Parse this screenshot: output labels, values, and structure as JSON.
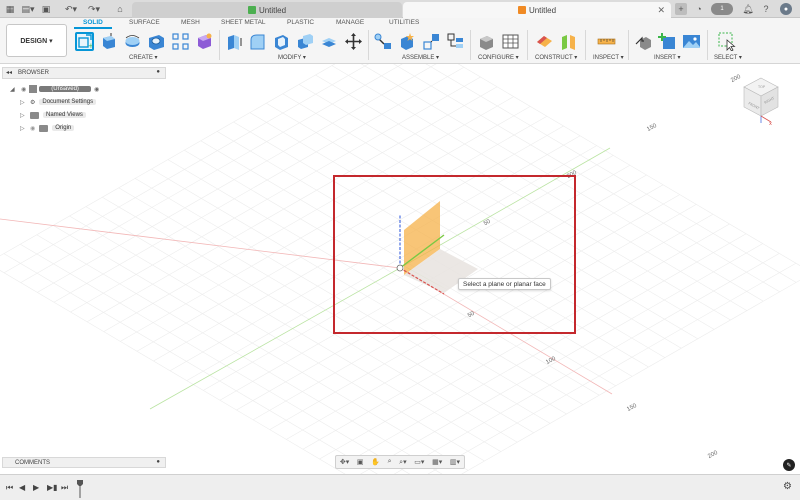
{
  "topbar": {
    "tab1_title": "Untitled",
    "tab2_title": "Untitled",
    "badge_count": "1"
  },
  "ribbon": {
    "workspace": "DESIGN ▾",
    "tabs": [
      "SOLID",
      "SURFACE",
      "MESH",
      "SHEET METAL",
      "PLASTIC",
      "MANAGE",
      "UTILITIES"
    ],
    "groups": [
      "CREATE ▾",
      "MODIFY ▾",
      "ASSEMBLE ▾",
      "CONFIGURE ▾",
      "CONSTRUCT ▾",
      "INSPECT ▾",
      "INSERT ▾",
      "SELECT ▾"
    ]
  },
  "browser": {
    "title": "BROWSER",
    "root": "(Unsaved)",
    "items": [
      "Document Settings",
      "Named Views",
      "Origin"
    ]
  },
  "comments": {
    "title": "COMMENTS"
  },
  "viewport": {
    "tooltip": "Select a plane or planar face",
    "axis_labels": [
      "150",
      "200",
      "50",
      "50",
      "100",
      "150",
      "200",
      "200"
    ]
  },
  "viewcube": {
    "top": "TOP",
    "front": "FRONT",
    "right": "RIGHT"
  },
  "colors": {
    "accent": "#0696d7",
    "highlight": "#c4282d",
    "plane_orange": "#f6b24a",
    "axis_green": "#7ac943",
    "axis_red": "#d9534f",
    "axis_blue": "#4a6ee0"
  }
}
